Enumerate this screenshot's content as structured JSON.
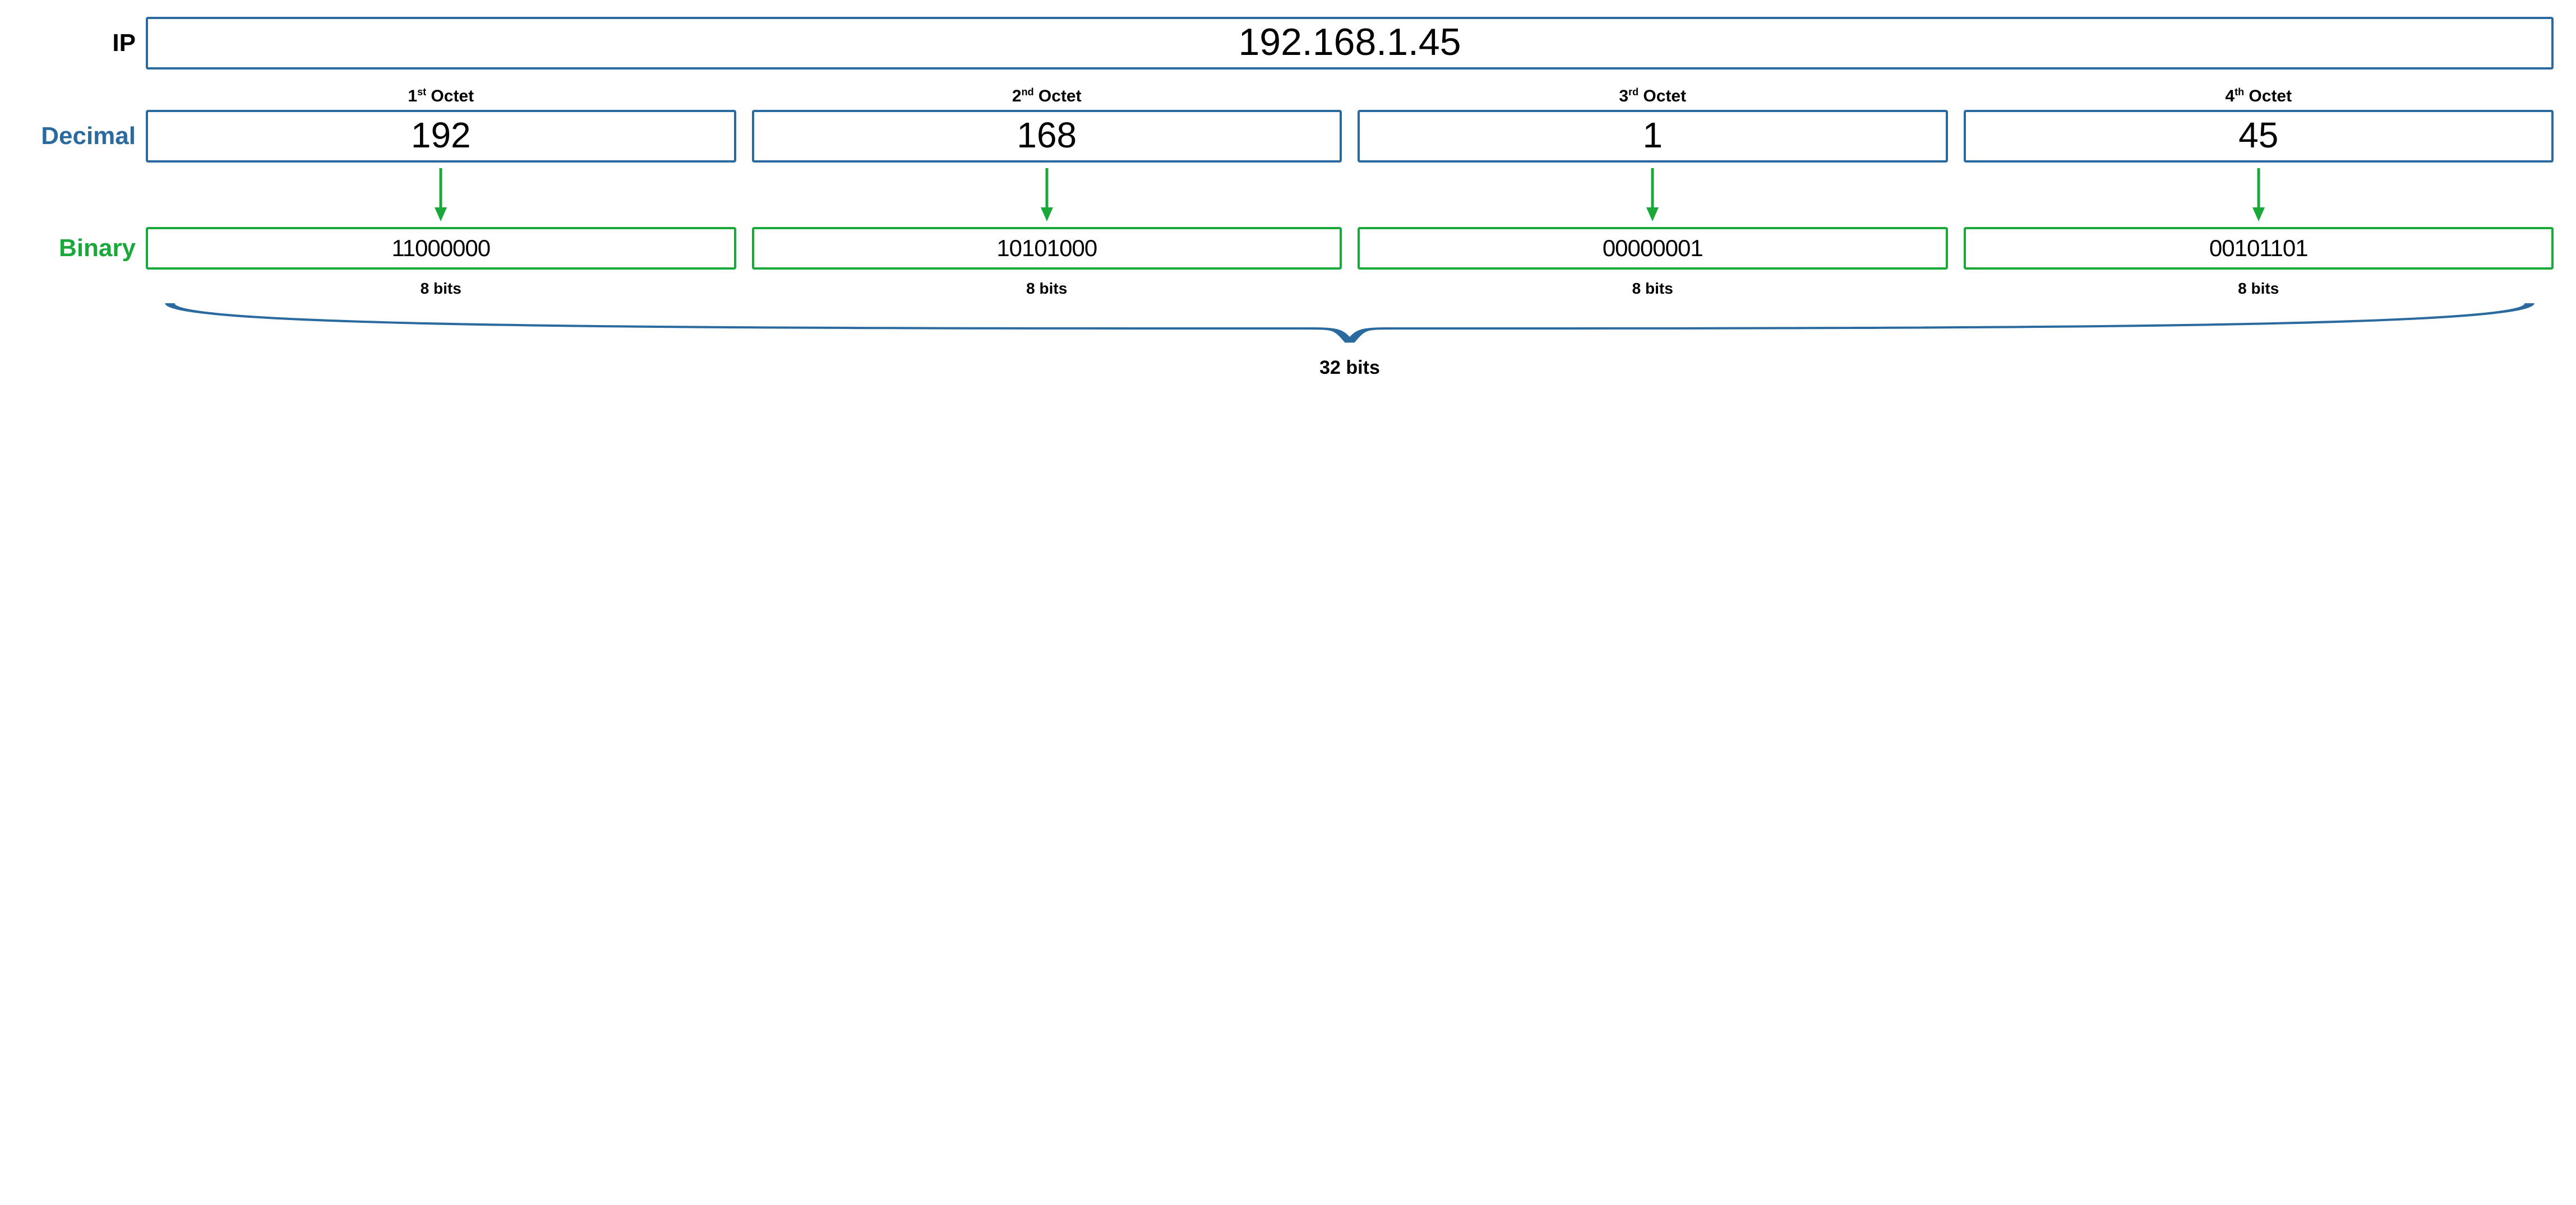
{
  "labels": {
    "ip": "IP",
    "decimal": "Decimal",
    "binary": "Binary",
    "total_bits": "32 bits"
  },
  "ip_address": "192.168.1.45",
  "octets": [
    {
      "ordinal": "1",
      "suffix": "st",
      "title_word": "Octet",
      "decimal": "192",
      "binary": "11000000",
      "bits_label": "8 bits"
    },
    {
      "ordinal": "2",
      "suffix": "nd",
      "title_word": "Octet",
      "decimal": "168",
      "binary": "10101000",
      "bits_label": "8 bits"
    },
    {
      "ordinal": "3",
      "suffix": "rd",
      "title_word": "Octet",
      "decimal": "1",
      "binary": "00000001",
      "bits_label": "8 bits"
    },
    {
      "ordinal": "4",
      "suffix": "th",
      "title_word": "Octet",
      "decimal": "45",
      "binary": "00101101",
      "bits_label": "8 bits"
    }
  ],
  "colors": {
    "blue": "#2a6a9e",
    "green": "#1aa83b"
  }
}
